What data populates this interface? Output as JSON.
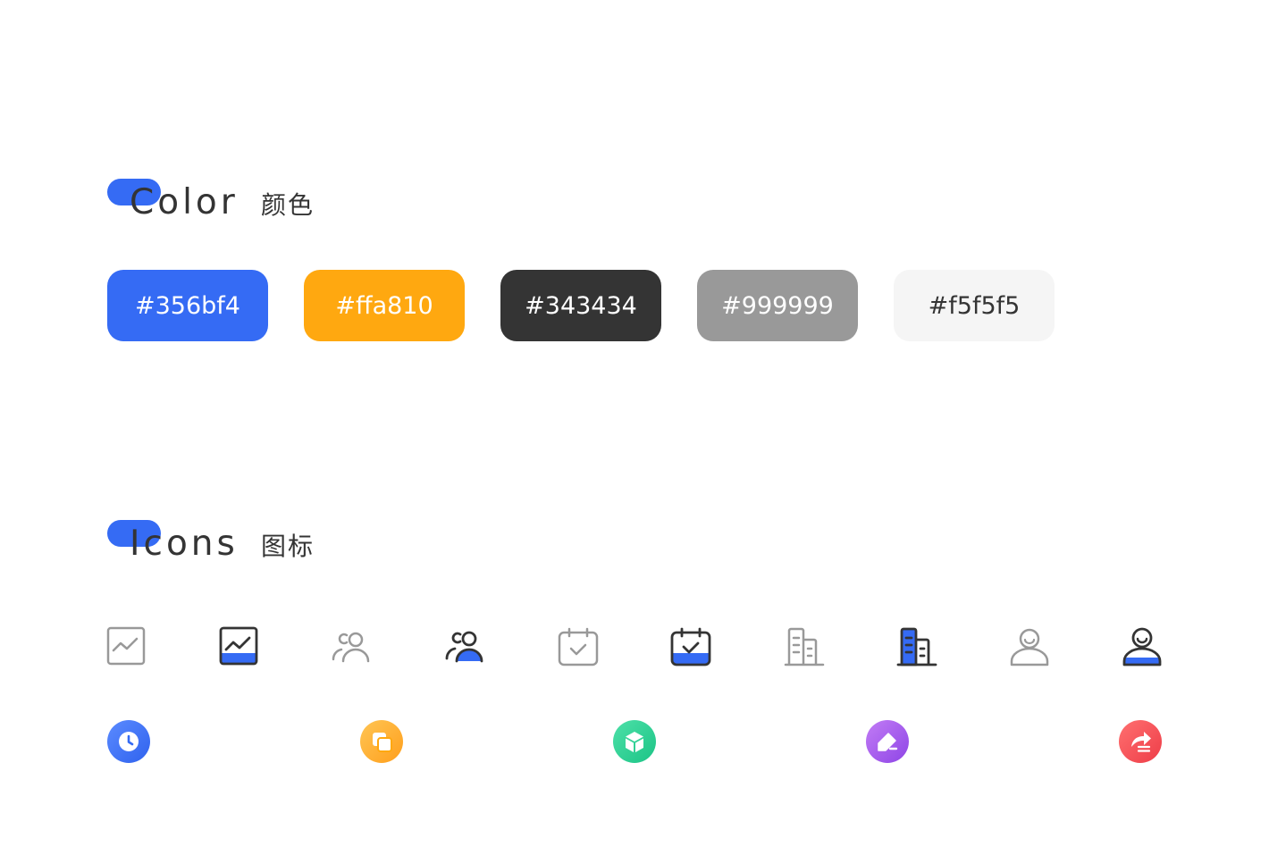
{
  "sections": {
    "color": {
      "title_en": "Color",
      "title_cn": "颜色"
    },
    "icons": {
      "title_en": "Icons",
      "title_cn": "图标"
    }
  },
  "accent_color": "#356bf4",
  "swatches": [
    {
      "label": "#356bf4",
      "background": "#356bf4",
      "text_color": "#ffffff"
    },
    {
      "label": "#ffa810",
      "background": "#ffa810",
      "text_color": "#ffffff"
    },
    {
      "label": "#343434",
      "background": "#343434",
      "text_color": "#ffffff"
    },
    {
      "label": "#999999",
      "background": "#999999",
      "text_color": "#ffffff"
    },
    {
      "label": "#f5f5f5",
      "background": "#f5f5f5",
      "text_color": "#343434"
    }
  ],
  "line_icons": [
    {
      "name": "chart-icon",
      "state": "inactive",
      "stroke": "#999999"
    },
    {
      "name": "chart-icon",
      "state": "active",
      "stroke": "#343434",
      "fill": "#356bf4"
    },
    {
      "name": "users-icon",
      "state": "inactive",
      "stroke": "#999999"
    },
    {
      "name": "users-icon",
      "state": "active",
      "stroke": "#343434",
      "fill": "#356bf4"
    },
    {
      "name": "calendar-check-icon",
      "state": "inactive",
      "stroke": "#999999"
    },
    {
      "name": "calendar-check-icon",
      "state": "active",
      "stroke": "#343434",
      "fill": "#356bf4"
    },
    {
      "name": "building-icon",
      "state": "inactive",
      "stroke": "#999999"
    },
    {
      "name": "building-icon",
      "state": "active",
      "stroke": "#343434",
      "fill": "#356bf4"
    },
    {
      "name": "user-icon",
      "state": "inactive",
      "stroke": "#999999"
    },
    {
      "name": "user-icon",
      "state": "active",
      "stroke": "#343434",
      "fill": "#356bf4"
    }
  ],
  "app_icons": [
    {
      "name": "clock-icon",
      "gradient": [
        "#5b8bff",
        "#2f62ee"
      ]
    },
    {
      "name": "copy-icon",
      "gradient": [
        "#ffc554",
        "#ff9f1c"
      ]
    },
    {
      "name": "box-icon",
      "gradient": [
        "#4de0a8",
        "#1cc486"
      ]
    },
    {
      "name": "edit-tag-icon",
      "gradient": [
        "#c27cf5",
        "#8e45e6"
      ]
    },
    {
      "name": "share-icon",
      "gradient": [
        "#ff7070",
        "#ee3d48"
      ]
    }
  ]
}
